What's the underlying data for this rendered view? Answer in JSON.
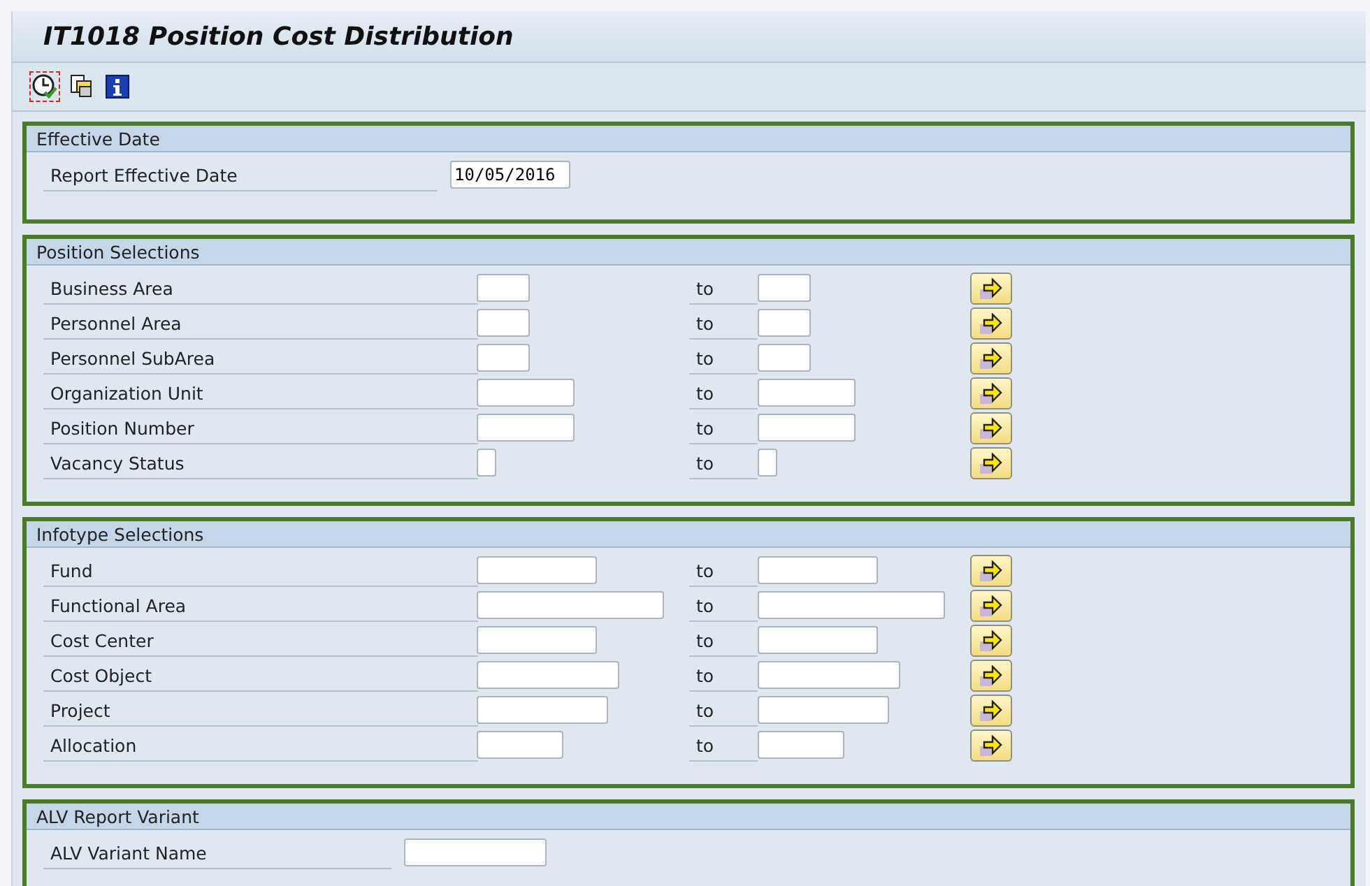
{
  "window": {
    "title": "IT1018 Position Cost Distribution"
  },
  "toolbar": [
    {
      "kind": "execute",
      "selected": true
    },
    {
      "kind": "variant",
      "selected": false
    },
    {
      "kind": "info",
      "selected": false
    }
  ],
  "sections": [
    {
      "title": "Effective Date",
      "rows": [
        {
          "kind": "single",
          "label": "Report Effective Date",
          "value": "10/05/2016"
        }
      ]
    },
    {
      "title": "Position Selections",
      "rows": [
        {
          "kind": "range",
          "label": "Business Area",
          "to": "to"
        },
        {
          "kind": "range",
          "label": "Personnel Area",
          "to": "to"
        },
        {
          "kind": "range",
          "label": "Personnel SubArea",
          "to": "to"
        },
        {
          "kind": "range",
          "label": "Organization Unit",
          "to": "to"
        },
        {
          "kind": "range",
          "label": "Position Number",
          "to": "to"
        },
        {
          "kind": "range",
          "label": "Vacancy Status",
          "to": "to"
        }
      ]
    },
    {
      "title": "Infotype Selections",
      "rows": [
        {
          "kind": "range",
          "label": "Fund",
          "to": "to"
        },
        {
          "kind": "range",
          "label": "Functional Area",
          "to": "to"
        },
        {
          "kind": "range",
          "label": "Cost Center",
          "to": "to"
        },
        {
          "kind": "range",
          "label": "Cost Object",
          "to": "to"
        },
        {
          "kind": "range",
          "label": "Project",
          "to": "to"
        },
        {
          "kind": "range",
          "label": "Allocation",
          "to": "to"
        }
      ]
    },
    {
      "title": "ALV Report Variant",
      "rows": [
        {
          "kind": "single",
          "label": "ALV Variant Name"
        }
      ]
    }
  ]
}
